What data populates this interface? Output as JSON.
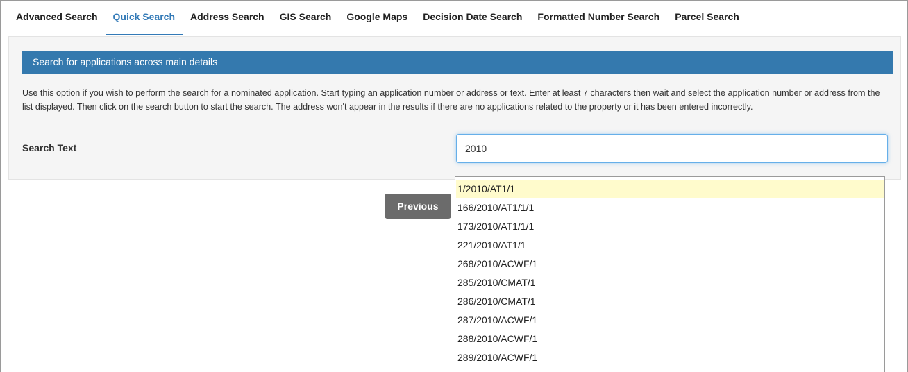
{
  "tabs": [
    {
      "label": "Advanced Search",
      "active": false
    },
    {
      "label": "Quick Search",
      "active": true
    },
    {
      "label": "Address Search",
      "active": false
    },
    {
      "label": "GIS Search",
      "active": false
    },
    {
      "label": "Google Maps",
      "active": false
    },
    {
      "label": "Decision Date Search",
      "active": false
    },
    {
      "label": "Formatted Number Search",
      "active": false
    },
    {
      "label": "Parcel Search",
      "active": false
    }
  ],
  "panel": {
    "heading": "Search for applications across main details",
    "description": "Use this option if you wish to perform the search for a nominated application. Start typing an application number or address or text. Enter at least 7 characters then wait and select the application number or address from the list displayed. Then click on the search button to start the search. The address won't appear in the results if there are no applications related to the property or it has been entered incorrectly.",
    "search_label": "Search Text",
    "search_value": "2010"
  },
  "buttons": {
    "previous": "Previous"
  },
  "dropdown": {
    "highlighted_index": 0,
    "items": [
      "1/2010/AT1/1",
      "166/2010/AT1/1/1",
      "173/2010/AT1/1/1",
      "221/2010/AT1/1",
      "268/2010/ACWF/1",
      "285/2010/CMAT/1",
      "286/2010/CMAT/1",
      "287/2010/ACWF/1",
      "288/2010/ACWF/1",
      "289/2010/ACWF/1"
    ]
  },
  "colors": {
    "accent": "#337ab7",
    "panel_heading_bg": "#3479ae",
    "highlight": "#fffbcc",
    "button_bg": "#6b6b6b"
  }
}
